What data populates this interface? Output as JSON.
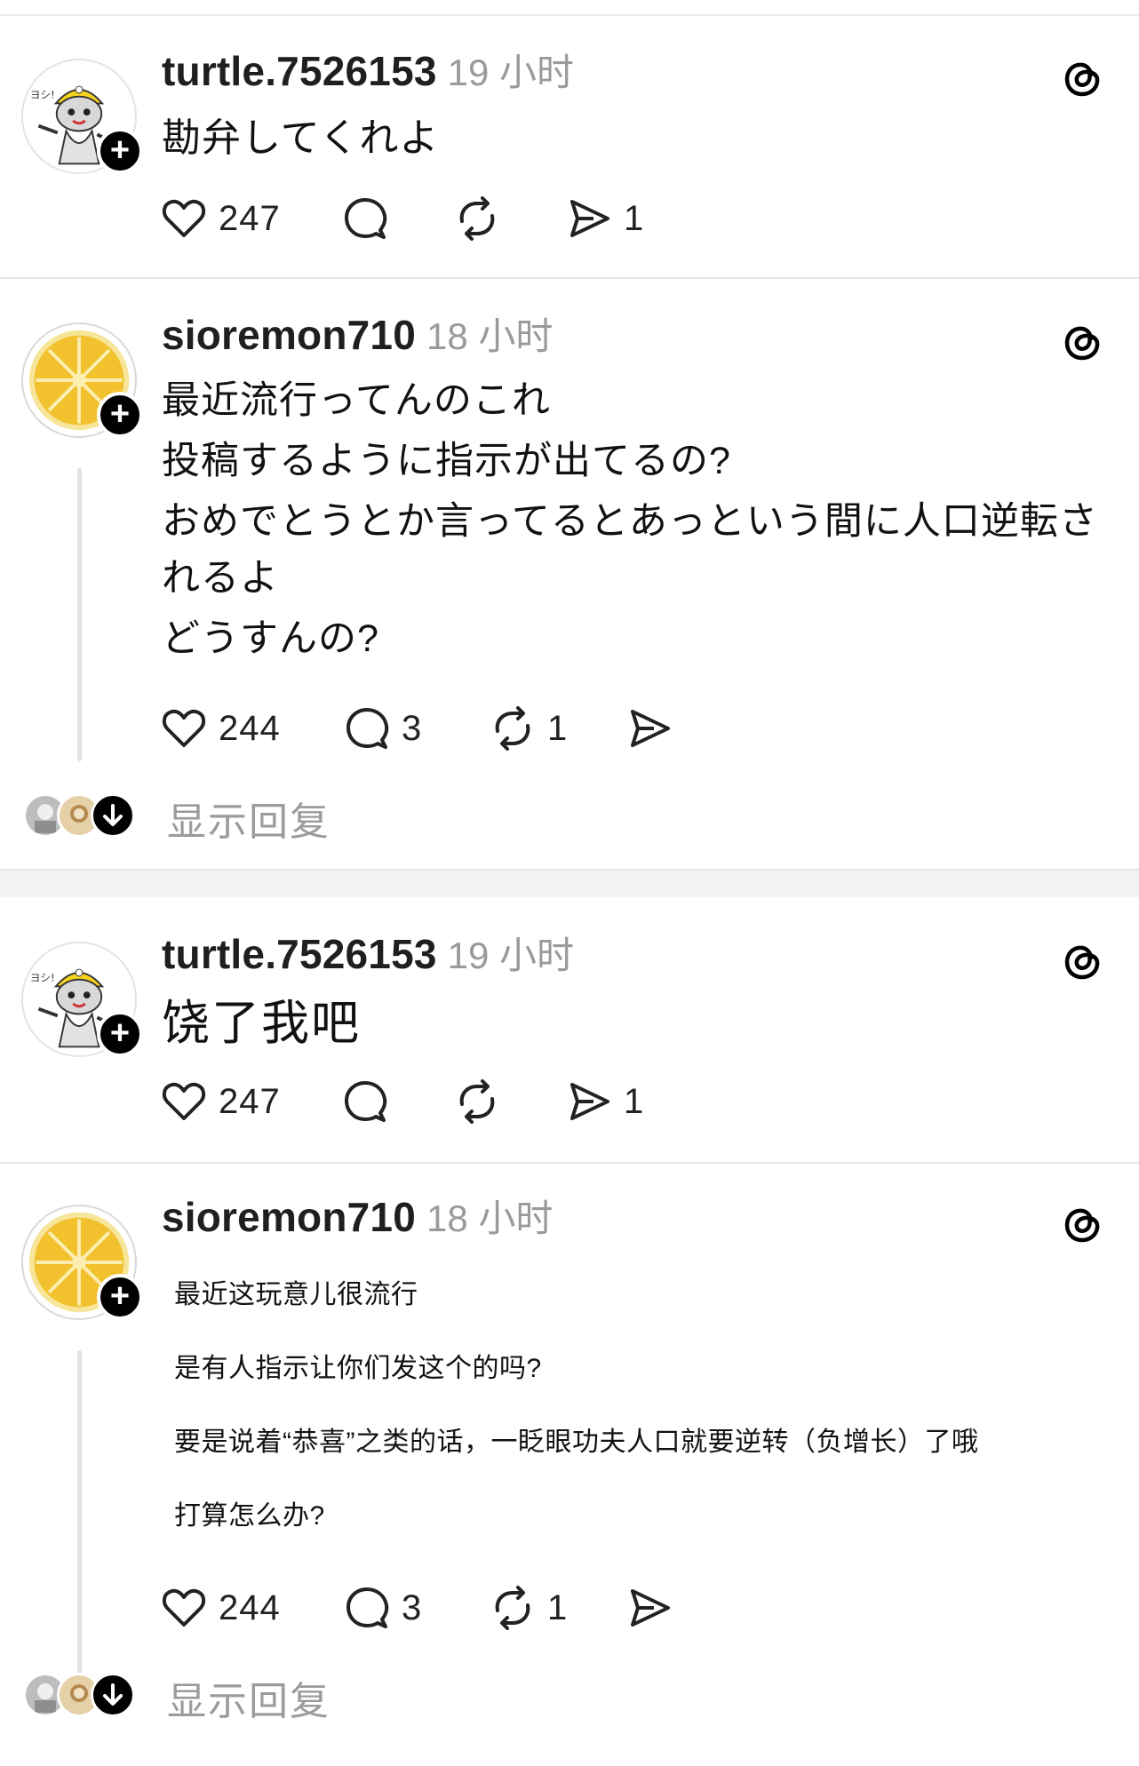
{
  "posts": [
    {
      "username": "turtle.7526153",
      "time": "19 小时",
      "lines": [
        "勘弁してくれよ"
      ],
      "likes": "247",
      "comments": "",
      "reposts": "",
      "shares": "1"
    },
    {
      "username": "sioremon710",
      "time": "18 小时",
      "lines": [
        "最近流行ってんのこれ",
        "投稿するように指示が出てるの?",
        "おめでとうとか言ってるとあっという間に人口逆転さ",
        "れるよ",
        "どうすんの?"
      ],
      "likes": "244",
      "comments": "3",
      "reposts": "1",
      "shares": "",
      "show_replies": "显示回复"
    },
    {
      "username": "turtle.7526153",
      "time": "19 小时",
      "lines": [
        "饶了我吧"
      ],
      "likes": "247",
      "comments": "",
      "reposts": "",
      "shares": "1"
    },
    {
      "username": "sioremon710",
      "time": "18 小时",
      "lines": [
        "最近这玩意儿很流行",
        "是有人指示让你们发这个的吗?",
        "要是说着“恭喜”之类的话，一眨眼功夫人口就要逆转（负增长）了哦",
        "打算怎么办?"
      ],
      "likes": "244",
      "comments": "3",
      "reposts": "1",
      "shares": "",
      "show_replies": "显示回复"
    }
  ],
  "colors": {
    "background": "#ffffff",
    "text": "#111111",
    "muted": "#9a9a9a",
    "divider": "#e6e6e6",
    "follow_badge": "#000000",
    "lemon": "#f2c12e"
  },
  "icons": [
    "heart-icon",
    "comment-icon",
    "repost-icon",
    "share-icon",
    "threads-logo-icon",
    "plus-icon",
    "arrow-down-icon"
  ]
}
